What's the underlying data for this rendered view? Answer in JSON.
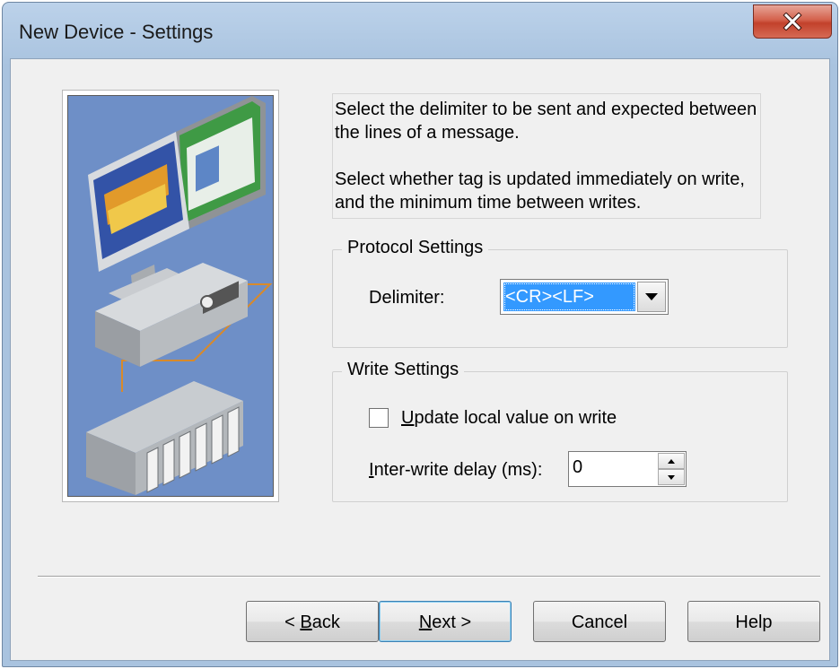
{
  "window": {
    "title": "New Device - Settings"
  },
  "description": {
    "line1": "Select the delimiter to be sent and expected between the lines of a message.",
    "line2": "Select whether tag is updated immediately on write, and the minimum time between writes."
  },
  "protocol_settings": {
    "title": "Protocol Settings",
    "delimiter_label": "Delimiter:",
    "delimiter_value": "<CR><LF>"
  },
  "write_settings": {
    "title": "Write Settings",
    "update_local_label_mnemonic": "U",
    "update_local_label_rest": "pdate local value on write",
    "update_local_checked": false,
    "inter_write_label_mnemonic": "I",
    "inter_write_label_rest": "nter-write delay (ms):",
    "inter_write_value": "0"
  },
  "buttons": {
    "back_prefix": "< ",
    "back_mnemonic": "B",
    "back_rest": "ack",
    "next_mnemonic": "N",
    "next_rest": "ext >",
    "cancel": "Cancel",
    "help": "Help"
  },
  "icons": {
    "close": "close-icon",
    "combo_arrow": "chevron-down-icon",
    "spin_up": "spin-up-icon",
    "spin_down": "spin-down-icon",
    "illustration": "device-network-illustration"
  },
  "colors": {
    "selection": "#3399ff",
    "close_button": "#c7432d",
    "illustration_bg": "#6e8fc7"
  }
}
